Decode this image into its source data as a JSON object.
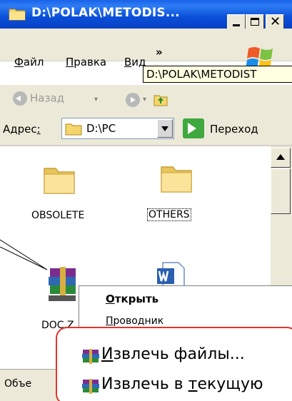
{
  "window": {
    "title": "D:\\POLAK\\METODIS...",
    "close_glyph": "✕"
  },
  "menu": {
    "file_first": "Ф",
    "file_rest": "айл",
    "edit_first": "П",
    "edit_rest": "равка",
    "view_first": "В",
    "view_rest": "ид",
    "more": "»"
  },
  "tooltip": "D:\\POLAK\\METODIST",
  "toolbar": {
    "back_label": "Назад",
    "drop_glyph": "▾"
  },
  "address": {
    "label": "Адрес",
    "label_underlined": ":",
    "value": "D:\\PC",
    "go_label": "Переход"
  },
  "files": [
    {
      "name": "OBSOLETE"
    },
    {
      "name": "OTHERS"
    },
    {
      "name": "DOC.Z"
    }
  ],
  "context_menu": {
    "open_first": "О",
    "open_rest": "ткрыть",
    "explorer_first": "П",
    "explorer_rest": "роводник"
  },
  "callout": {
    "extract_files_first": "И",
    "extract_files_rest": "звлечь файлы...",
    "extract_here_pre": "Извлечь в ",
    "extract_here_u": "т",
    "extract_here_rest": "екущую"
  },
  "status": "Объе",
  "colors": {
    "titlebar": "#0a4fd8",
    "chrome": "#ece9d8",
    "callout_border": "#e0352b",
    "tooltip_bg": "#ffffe1"
  }
}
